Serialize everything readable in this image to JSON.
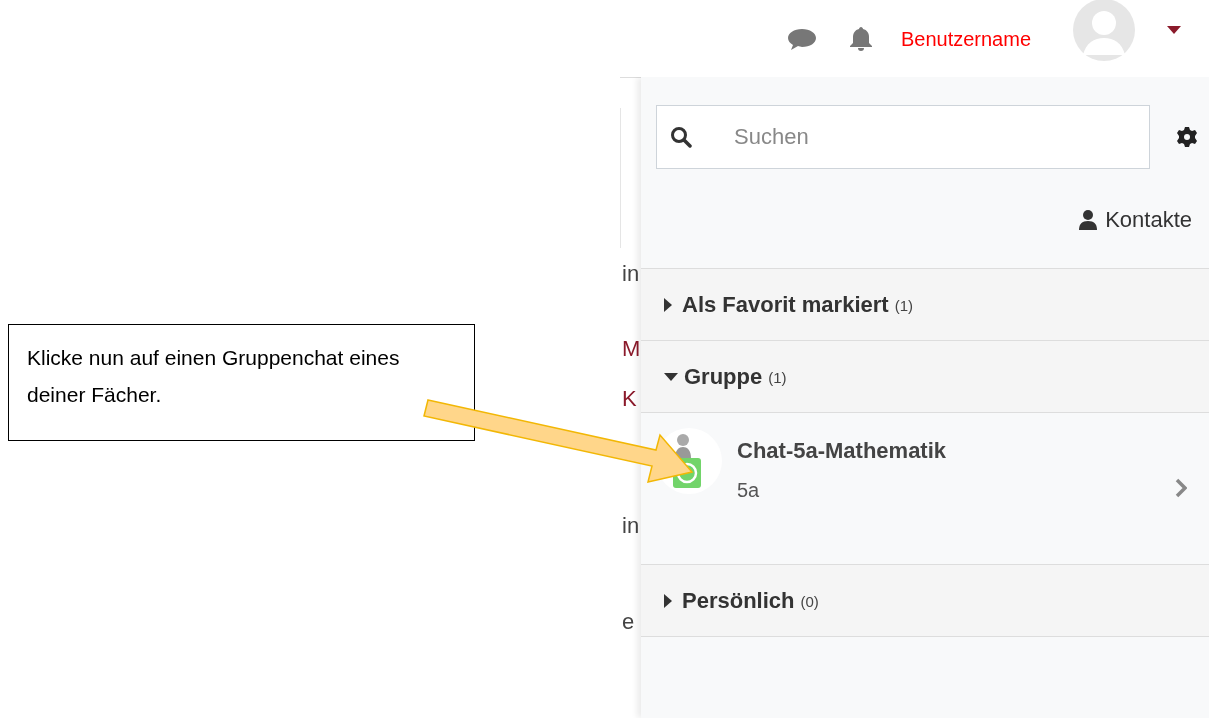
{
  "header": {
    "username": "Benutzername"
  },
  "search": {
    "placeholder": "Suchen"
  },
  "contacts_link": "Kontakte",
  "sections": [
    {
      "title": "Als Favorit markiert",
      "count": "(1)",
      "expanded": false
    },
    {
      "title": "Gruppe",
      "count": "(1)",
      "expanded": true,
      "conversations": [
        {
          "name": "Chat-5a-Mathematik",
          "subtitle": "5a"
        }
      ]
    },
    {
      "title": "Persönlich",
      "count": "(0)",
      "expanded": false
    }
  ],
  "background_fragments": [
    {
      "text": "in",
      "color": "#444444"
    },
    {
      "text": "M",
      "color": "#8b1a2b"
    },
    {
      "text": "K",
      "color": "#8b1a2b"
    },
    {
      "text": "in",
      "color": "#444444"
    },
    {
      "text": "e",
      "color": "#444444"
    }
  ],
  "annotation": {
    "text": "Klicke nun auf einen Gruppenchat eines deiner Fächer."
  }
}
